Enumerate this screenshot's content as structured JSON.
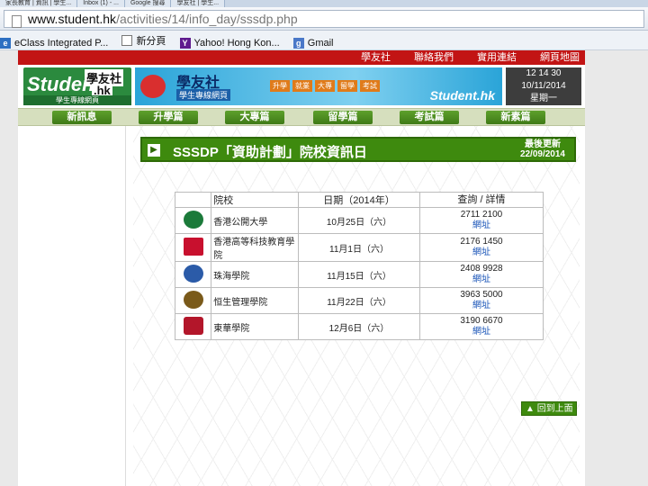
{
  "browser": {
    "tabs": [
      "家長教育 | 資訊 | 學生...",
      "Inbox (1) - ...",
      "Google 搜尋",
      "學友社 | 學生..."
    ],
    "url_host": "www.student.hk",
    "url_path": "/activities/14/info_day/sssdp.php",
    "bookmarks": [
      "eClass Integrated P...",
      "新分頁",
      "Yahoo! Hong Kon...",
      "Gmail"
    ]
  },
  "site": {
    "top_links": [
      "學友社",
      "聯絡我們",
      "實用連結",
      "網頁地圖"
    ],
    "logo_main": "Student",
    "logo_cn": "學友社",
    "logo_hk": ".hk",
    "logo_sub": "學生專線網頁",
    "banner_title": "學友社",
    "banner_sub": "學生專線網頁",
    "banner_steps": [
      "升學",
      "就業",
      "大專",
      "留學",
      "考試"
    ],
    "banner_brand": "Student.hk",
    "clock": "12 14 30",
    "date": "10/11/2014",
    "weekday": "星期一",
    "main_nav": [
      "新訊息",
      "升學篇",
      "大專篇",
      "留學篇",
      "考試篇",
      "新素篇"
    ]
  },
  "content": {
    "title": "SSSDP「資助計劃」院校資訊日",
    "update_label": "最後更新",
    "update_date": "22/09/2014",
    "table_headers": [
      "院校",
      "日期（2014年）",
      "查詢 / 詳情"
    ],
    "rows": [
      {
        "name": "香港公開大學",
        "date": "10月25日（六）",
        "phone": "2711 2100",
        "link": "網址",
        "color": "#1b7a3a"
      },
      {
        "name": "香港高等科技教育學院",
        "date": "11月1日（六）",
        "phone": "2176 1450",
        "link": "網址",
        "color": "#c8102e"
      },
      {
        "name": "珠海學院",
        "date": "11月15日（六）",
        "phone": "2408 9928",
        "link": "網址",
        "color": "#2b5ba8"
      },
      {
        "name": "恒生管理學院",
        "date": "11月22日（六）",
        "phone": "3963 5000",
        "link": "網址",
        "color": "#7a5a1a"
      },
      {
        "name": "東華學院",
        "date": "12月6日（六）",
        "phone": "3190 6670",
        "link": "網址",
        "color": "#b3162a"
      }
    ],
    "back_to_top": "回到上面"
  }
}
